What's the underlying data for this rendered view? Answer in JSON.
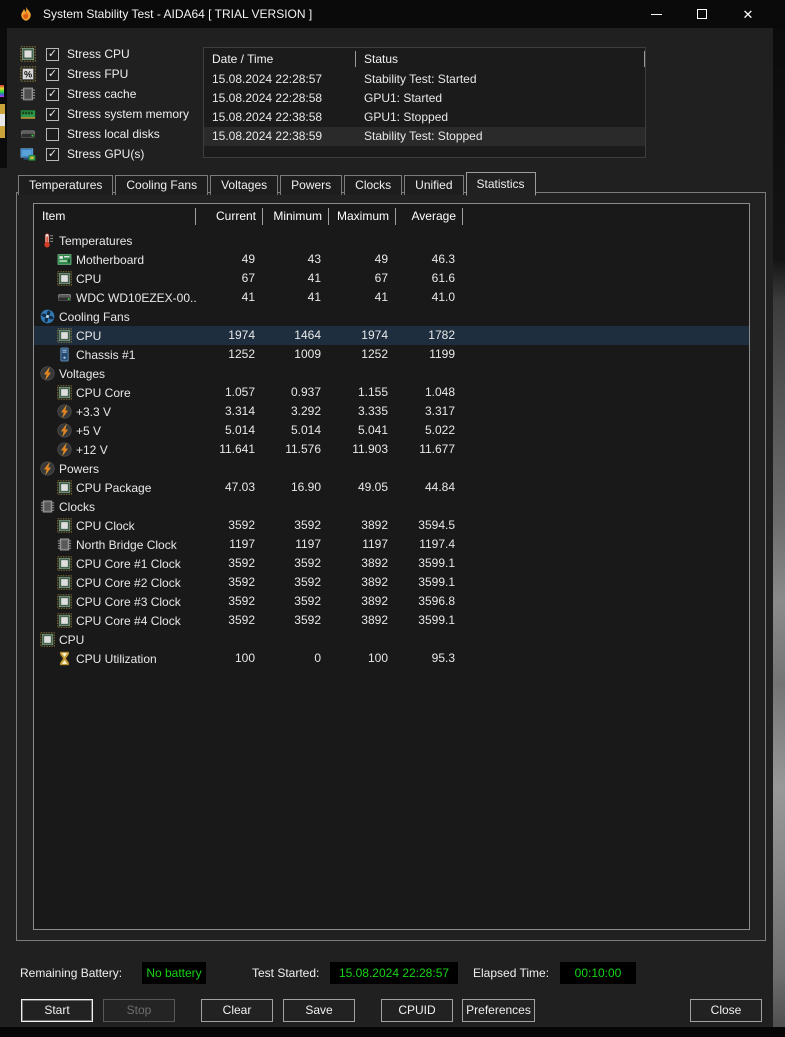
{
  "titlebar": {
    "title": "System Stability Test - AIDA64  [ TRIAL VERSION ]"
  },
  "stress_options": [
    {
      "icon": "cpu",
      "label": "Stress CPU",
      "checked": true
    },
    {
      "icon": "fpu",
      "label": "Stress FPU",
      "checked": true
    },
    {
      "icon": "cache",
      "label": "Stress cache",
      "checked": true
    },
    {
      "icon": "memory",
      "label": "Stress system memory",
      "checked": true
    },
    {
      "icon": "disk",
      "label": "Stress local disks",
      "checked": false
    },
    {
      "icon": "gpu",
      "label": "Stress GPU(s)",
      "checked": true
    }
  ],
  "log": {
    "columns": [
      "Date / Time",
      "Status"
    ],
    "rows": [
      [
        "15.08.2024 22:28:57",
        "Stability Test: Started"
      ],
      [
        "15.08.2024 22:28:58",
        "GPU1: Started"
      ],
      [
        "15.08.2024 22:38:58",
        "GPU1: Stopped"
      ],
      [
        "15.08.2024 22:38:59",
        "Stability Test: Stopped"
      ]
    ],
    "highlighted_row": 3
  },
  "tabs": [
    {
      "label": "Temperatures",
      "active": false
    },
    {
      "label": "Cooling Fans",
      "active": false
    },
    {
      "label": "Voltages",
      "active": false
    },
    {
      "label": "Powers",
      "active": false
    },
    {
      "label": "Clocks",
      "active": false
    },
    {
      "label": "Unified",
      "active": false
    },
    {
      "label": "Statistics",
      "active": true
    }
  ],
  "stats": {
    "columns": [
      "Item",
      "Current",
      "Minimum",
      "Maximum",
      "Average"
    ],
    "rows": [
      {
        "type": "group",
        "icon": "thermometer",
        "label": "Temperatures"
      },
      {
        "type": "item",
        "icon": "motherboard",
        "label": "Motherboard",
        "values": [
          "49",
          "43",
          "49",
          "46.3"
        ]
      },
      {
        "type": "item",
        "icon": "cpu",
        "label": "CPU",
        "values": [
          "67",
          "41",
          "67",
          "61.6"
        ]
      },
      {
        "type": "item",
        "icon": "disk",
        "label": "WDC WD10EZEX-00...",
        "values": [
          "41",
          "41",
          "41",
          "41.0"
        ]
      },
      {
        "type": "group",
        "icon": "fan",
        "label": "Cooling Fans"
      },
      {
        "type": "item",
        "icon": "cpu",
        "label": "CPU",
        "values": [
          "1974",
          "1464",
          "1974",
          "1782"
        ],
        "selected": true
      },
      {
        "type": "item",
        "icon": "chassis",
        "label": "Chassis #1",
        "values": [
          "1252",
          "1009",
          "1252",
          "1199"
        ]
      },
      {
        "type": "group",
        "icon": "bolt",
        "label": "Voltages"
      },
      {
        "type": "item",
        "icon": "cpu",
        "label": "CPU Core",
        "values": [
          "1.057",
          "0.937",
          "1.155",
          "1.048"
        ]
      },
      {
        "type": "item",
        "icon": "bolt",
        "label": "+3.3 V",
        "values": [
          "3.314",
          "3.292",
          "3.335",
          "3.317"
        ]
      },
      {
        "type": "item",
        "icon": "bolt",
        "label": "+5 V",
        "values": [
          "5.014",
          "5.014",
          "5.041",
          "5.022"
        ]
      },
      {
        "type": "item",
        "icon": "bolt",
        "label": "+12 V",
        "values": [
          "11.641",
          "11.576",
          "11.903",
          "11.677"
        ]
      },
      {
        "type": "group",
        "icon": "bolt",
        "label": "Powers"
      },
      {
        "type": "item",
        "icon": "cpu",
        "label": "CPU Package",
        "values": [
          "47.03",
          "16.90",
          "49.05",
          "44.84"
        ]
      },
      {
        "type": "group",
        "icon": "chip",
        "label": "Clocks"
      },
      {
        "type": "item",
        "icon": "cpu",
        "label": "CPU Clock",
        "values": [
          "3592",
          "3592",
          "3892",
          "3594.5"
        ]
      },
      {
        "type": "item",
        "icon": "chip",
        "label": "North Bridge Clock",
        "values": [
          "1197",
          "1197",
          "1197",
          "1197.4"
        ]
      },
      {
        "type": "item",
        "icon": "cpu",
        "label": "CPU Core #1 Clock",
        "values": [
          "3592",
          "3592",
          "3892",
          "3599.1"
        ]
      },
      {
        "type": "item",
        "icon": "cpu",
        "label": "CPU Core #2 Clock",
        "values": [
          "3592",
          "3592",
          "3892",
          "3599.1"
        ]
      },
      {
        "type": "item",
        "icon": "cpu",
        "label": "CPU Core #3 Clock",
        "values": [
          "3592",
          "3592",
          "3892",
          "3596.8"
        ]
      },
      {
        "type": "item",
        "icon": "cpu",
        "label": "CPU Core #4 Clock",
        "values": [
          "3592",
          "3592",
          "3892",
          "3599.1"
        ]
      },
      {
        "type": "group",
        "icon": "cpu",
        "label": "CPU"
      },
      {
        "type": "item",
        "icon": "hourglass",
        "label": "CPU Utilization",
        "values": [
          "100",
          "0",
          "100",
          "95.3"
        ]
      }
    ]
  },
  "status_bar": {
    "battery_label": "Remaining Battery:",
    "battery_value": "No battery",
    "started_label": "Test Started:",
    "started_value": "15.08.2024 22:28:57",
    "elapsed_label": "Elapsed Time:",
    "elapsed_value": "00:10:00"
  },
  "action_buttons": [
    {
      "label": "Start",
      "focused": true
    },
    {
      "label": "Stop",
      "disabled": true
    },
    {
      "label": "Clear"
    },
    {
      "label": "Save"
    },
    {
      "label": "CPUID"
    },
    {
      "label": "Preferences"
    },
    {
      "label": "Close"
    }
  ],
  "colors": {
    "status_green": "#17d417",
    "selected_row_bg": "#1e2e3f",
    "titlebar_bg": "#0a0a0a",
    "window_bg": "#202020",
    "accent_orange": "#e67e22"
  }
}
